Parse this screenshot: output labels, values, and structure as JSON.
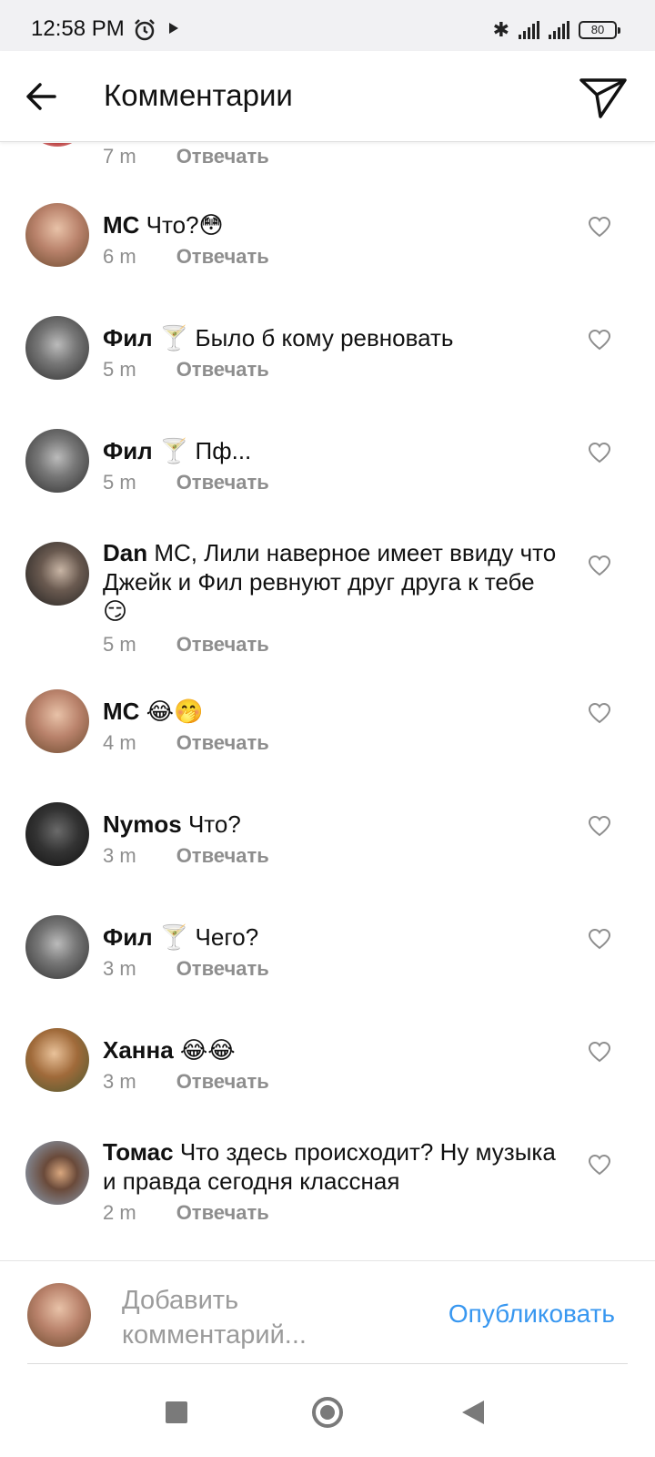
{
  "status_bar": {
    "time": "12:58 PM",
    "battery": "80",
    "icons": [
      "alarm-icon",
      "play-icon",
      "bluetooth-icon",
      "signal-icon",
      "battery-icon"
    ]
  },
  "header": {
    "title": "Комментарии",
    "back_icon": "arrow-left-icon",
    "share_icon": "paper-plane-icon"
  },
  "partial_comment": {
    "time": "7 m",
    "reply_label": "Отвечать"
  },
  "comments": [
    {
      "user": "MC",
      "text": "Что?😳",
      "time": "6 m",
      "reply_label": "Отвечать",
      "avatar_color": "#b9826b"
    },
    {
      "user": "Фил",
      "text": "🍸 Было б кому ревновать",
      "time": "5 m",
      "reply_label": "Отвечать",
      "avatar_color": "#4a4a4a"
    },
    {
      "user": "Фил",
      "text": "🍸 Пф...",
      "time": "5 m",
      "reply_label": "Отвечать",
      "avatar_color": "#4a4a4a"
    },
    {
      "user": "Dan",
      "text": "MC, Лили наверное имеет ввиду что Джейк и Фил ревнуют друг друга к тебе😏",
      "time": "5 m",
      "reply_label": "Отвечать",
      "avatar_color": "#3a3a3a"
    },
    {
      "user": "MC",
      "text": "😂🤭",
      "time": "4 m",
      "reply_label": "Отвечать",
      "avatar_color": "#b9826b"
    },
    {
      "user": "Nymos",
      "text": "Что?",
      "time": "3 m",
      "reply_label": "Отвечать",
      "avatar_color": "#1e1e1e"
    },
    {
      "user": "Фил",
      "text": "🍸 Чего?",
      "time": "3 m",
      "reply_label": "Отвечать",
      "avatar_color": "#4a4a4a"
    },
    {
      "user": "Ханна",
      "text": "😂😂",
      "time": "3 m",
      "reply_label": "Отвечать",
      "avatar_color": "#a06a3a"
    },
    {
      "user": "Томас",
      "text": "Что здесь происходит? Ну музыка и правда сегодня классная",
      "time": "2 m",
      "reply_label": "Отвечать",
      "avatar_color": "#5c6b7a"
    }
  ],
  "composer": {
    "placeholder": "Добавить комментарий...",
    "publish_label": "Опубликовать"
  },
  "colors": {
    "accent": "#3897f0",
    "meta_gray": "#8e8e8e"
  }
}
